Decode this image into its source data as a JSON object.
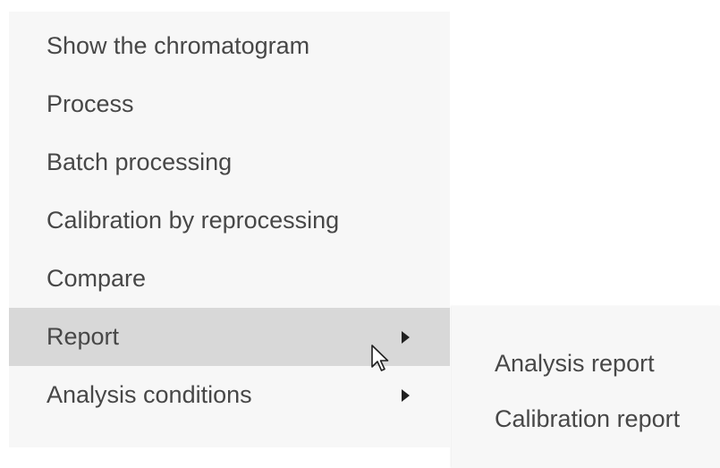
{
  "context_menu": {
    "items": [
      {
        "label": "Show the chromatogram",
        "has_submenu": false,
        "highlighted": false
      },
      {
        "label": "Process",
        "has_submenu": false,
        "highlighted": false
      },
      {
        "label": "Batch processing",
        "has_submenu": false,
        "highlighted": false
      },
      {
        "label": "Calibration by reprocessing",
        "has_submenu": false,
        "highlighted": false
      },
      {
        "label": "Compare",
        "has_submenu": false,
        "highlighted": false
      },
      {
        "label": "Report",
        "has_submenu": true,
        "highlighted": true
      },
      {
        "label": "Analysis conditions",
        "has_submenu": true,
        "highlighted": false
      }
    ]
  },
  "report_submenu": {
    "items": [
      {
        "label": "Analysis report"
      },
      {
        "label": "Calibration report"
      }
    ]
  },
  "icons": {
    "submenu_arrow": "triangle-right-icon",
    "cursor": "mouse-pointer-icon"
  },
  "colors": {
    "menu_background": "#f7f7f7",
    "highlight": "#d8d8d8",
    "text": "#474747"
  }
}
